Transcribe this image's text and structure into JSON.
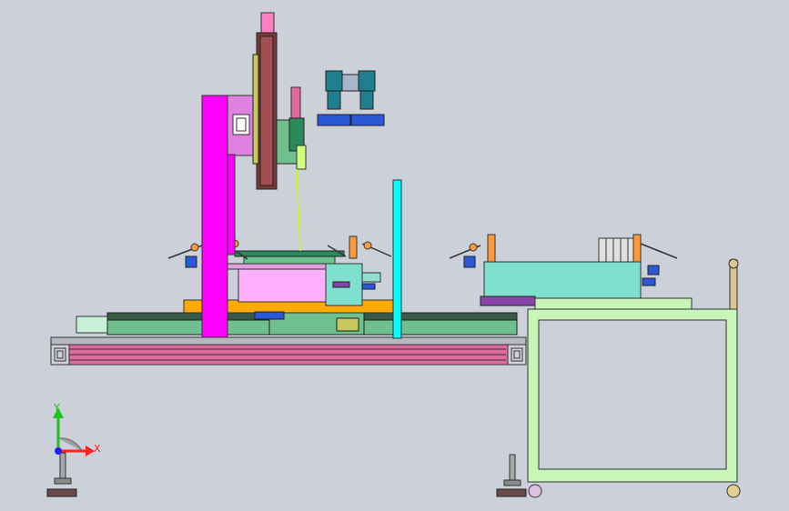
{
  "viewport": {
    "background": "#cbd0d9",
    "colors": {
      "pillar": "#ff00ff",
      "rail": "#e06aa0",
      "slide_bed": "#6fbf8f",
      "platform": "#ffaa00",
      "cyan_post": "#00ffff",
      "work_box": "#ffb0ff",
      "fixture_block": "#7fe0cf",
      "cart_frame": "#c8f5b8",
      "camera": "#1f7f8f",
      "lens_ring": "#2a58d8",
      "clamp_accent": "#ff9a3c"
    }
  },
  "triad": {
    "x_label": "X",
    "y_label": "Y",
    "x_color": "#ff2020",
    "y_color": "#20c020",
    "z_color": "#2020ff"
  }
}
